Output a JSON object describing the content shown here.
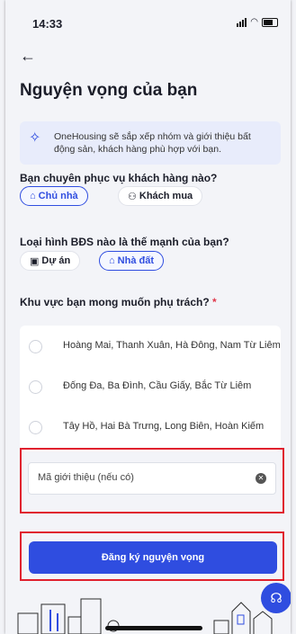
{
  "status_bar": {
    "time": "14:33"
  },
  "header": {
    "back_icon": "arrow-left-icon",
    "title": "Nguyện vọng của bạn"
  },
  "banner": {
    "icon": "sparkle-icon",
    "text": "OneHousing sẽ sắp xếp nhóm và giới thiệu bất động sản, khách hàng phù hợp với bạn."
  },
  "customer_question": {
    "label": "Bạn chuyên phục vụ khách hàng nào?",
    "options": [
      {
        "label": "Chủ nhà",
        "icon": "house-icon",
        "selected": true
      },
      {
        "label": "Khách mua",
        "icon": "people-icon",
        "selected": false
      }
    ]
  },
  "property_question": {
    "label": "Loại hình BĐS nào là thế mạnh của bạn?",
    "options": [
      {
        "label": "Dự án",
        "icon": "building-icon",
        "selected": false
      },
      {
        "label": "Nhà đất",
        "icon": "house-icon",
        "selected": true
      }
    ]
  },
  "area_question": {
    "label": "Khu vực bạn mong muốn phụ trách?",
    "required_mark": "*",
    "options": [
      "Hoàng Mai, Thanh Xuân, Hà Đông, Nam Từ Liêm",
      "Đống Đa, Ba Đình, Cầu Giấy, Bắc Từ Liêm",
      "Tây Hồ, Hai Bà Trưng, Long Biên, Hoàn Kiếm"
    ]
  },
  "referral": {
    "placeholder": "Mã giới thiệu (nếu có)"
  },
  "submit": {
    "label": "Đăng ký nguyện vọng"
  },
  "support": {
    "icon": "headset-icon"
  },
  "colors": {
    "accent": "#2f4de0",
    "highlight": "#e0212e",
    "background": "#f3f4f8"
  }
}
